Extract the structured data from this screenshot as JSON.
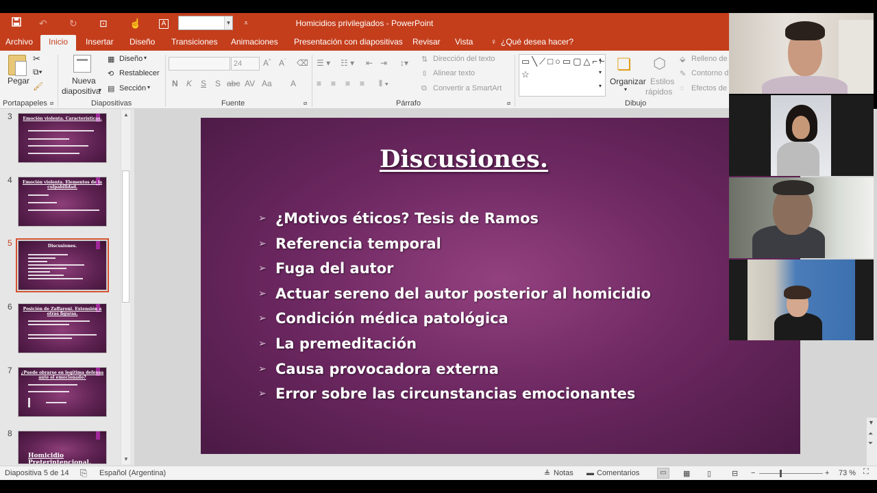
{
  "window": {
    "title": "Homicidios privilegiados - PowerPoint"
  },
  "quick_access": {
    "icons": [
      "save-icon",
      "undo-icon",
      "redo-icon",
      "present-icon",
      "touch-mode-icon",
      "font-color-icon"
    ]
  },
  "tabs": [
    "Archivo",
    "Inicio",
    "Insertar",
    "Diseño",
    "Transiciones",
    "Animaciones",
    "Presentación con diapositivas",
    "Revisar",
    "Vista"
  ],
  "active_tab": "Inicio",
  "tell_me": "¿Qué desea hacer?",
  "ribbon": {
    "clipboard": {
      "paste": "Pegar",
      "group": "Portapapeles"
    },
    "slides": {
      "new_slide_1": "Nueva",
      "new_slide_2": "diapositiva",
      "layout": "Diseño",
      "reset": "Restablecer",
      "section": "Sección",
      "group": "Diapositivas"
    },
    "font": {
      "size": "24",
      "group": "Fuente",
      "buttons": [
        "N",
        "K",
        "S",
        "S",
        "abc",
        "AV",
        "Aa",
        "A"
      ]
    },
    "paragraph": {
      "text_direction": "Dirección del texto",
      "align_text": "Alinear texto",
      "smartart": "Convertir a SmartArt",
      "group": "Párrafo"
    },
    "drawing": {
      "shapes_preview": "▭╲⟋□○▭▢△⌐⌐⇨⇩⌒↶↷⌣⌢{}☆",
      "arrange": "Organizar",
      "quick_styles_1": "Estilos",
      "quick_styles_2": "rápidos",
      "fill": "Relleno de",
      "outline": "Contorno d",
      "effects": "Efectos de",
      "group": "Dibujo"
    }
  },
  "thumbnails": [
    {
      "num": "3",
      "title": "Emoción violenta. Características."
    },
    {
      "num": "4",
      "title": "Emoción violenta. Elementos de la culpabilidad."
    },
    {
      "num": "5",
      "title": "Discusiones."
    },
    {
      "num": "6",
      "title": "Posición de Zaffaroni. Extensión a otras figuras."
    },
    {
      "num": "7",
      "title": "¿Puede obrarse en legítima defensa ante el emocionado?"
    },
    {
      "num": "8",
      "title": "Homicidio Preterintencional."
    }
  ],
  "slide": {
    "title": "Discusiones.",
    "bullets": [
      "¿Motivos éticos? Tesis de Ramos",
      "Referencia temporal",
      "Fuga del autor",
      "Actuar sereno del autor posterior al homicidio",
      "Condición médica patológica",
      "La premeditación",
      "Causa provocadora externa",
      "Error sobre las circunstancias emocionantes"
    ]
  },
  "status": {
    "slide_info": "Diapositiva 5 de 14",
    "language": "Español (Argentina)",
    "notes": "Notas",
    "comments": "Comentarios",
    "zoom": "73 %"
  }
}
